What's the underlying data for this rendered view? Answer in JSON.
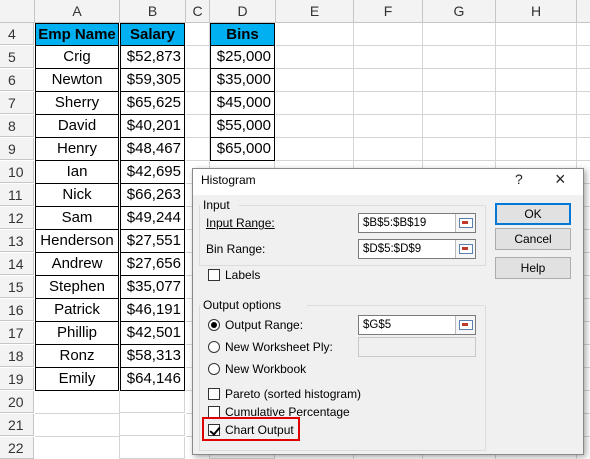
{
  "columns": [
    "A",
    "B",
    "C",
    "D",
    "E",
    "F",
    "G",
    "H"
  ],
  "rows": [
    {
      "n": "4",
      "a": "Emp Name",
      "b": "Salary",
      "d": "Bins"
    },
    {
      "n": "5",
      "a": "Crig",
      "b": "$52,873",
      "d": "$25,000"
    },
    {
      "n": "6",
      "a": "Newton",
      "b": "$59,305",
      "d": "$35,000"
    },
    {
      "n": "7",
      "a": "Sherry",
      "b": "$65,625",
      "d": "$45,000"
    },
    {
      "n": "8",
      "a": "David",
      "b": "$40,201",
      "d": "$55,000"
    },
    {
      "n": "9",
      "a": "Henry",
      "b": "$48,467",
      "d": "$65,000"
    },
    {
      "n": "10",
      "a": "Ian",
      "b": "$42,695",
      "d": ""
    },
    {
      "n": "11",
      "a": "Nick",
      "b": "$66,263",
      "d": ""
    },
    {
      "n": "12",
      "a": "Sam",
      "b": "$49,244",
      "d": ""
    },
    {
      "n": "13",
      "a": "Henderson",
      "b": "$27,551",
      "d": ""
    },
    {
      "n": "14",
      "a": "Andrew",
      "b": "$27,656",
      "d": ""
    },
    {
      "n": "15",
      "a": "Stephen",
      "b": "$35,077",
      "d": ""
    },
    {
      "n": "16",
      "a": "Patrick",
      "b": "$46,191",
      "d": ""
    },
    {
      "n": "17",
      "a": "Phillip",
      "b": "$42,501",
      "d": ""
    },
    {
      "n": "18",
      "a": "Ronz",
      "b": "$58,313",
      "d": ""
    },
    {
      "n": "19",
      "a": "Emily",
      "b": "$64,146",
      "d": ""
    },
    {
      "n": "20",
      "a": "",
      "b": "",
      "d": ""
    },
    {
      "n": "21",
      "a": "",
      "b": "",
      "d": ""
    },
    {
      "n": "22",
      "a": "",
      "b": "",
      "d": ""
    }
  ],
  "dialog": {
    "title": "Histogram",
    "help_glyph": "?",
    "close_glyph": "×",
    "input_group": "Input",
    "input_range_label": "Input Range:",
    "input_range_value": "$B$5:$B$19",
    "bin_range_label": "Bin Range:",
    "bin_range_value": "$D$5:$D$9",
    "labels_label": "Labels",
    "output_group": "Output options",
    "output_range_label": "Output Range:",
    "output_range_value": "$G$5",
    "new_ply_label": "New Worksheet Ply:",
    "new_workbook_label": "New Workbook",
    "pareto_label": "Pareto (sorted histogram)",
    "cumulative_label": "Cumulative Percentage",
    "chart_output_label": "Chart Output",
    "ok_label": "OK",
    "cancel_label": "Cancel",
    "help_label": "Help"
  },
  "colors": {
    "header_fill": "#00b0f0",
    "highlight": "#e00000",
    "arrow": "#e00000"
  }
}
